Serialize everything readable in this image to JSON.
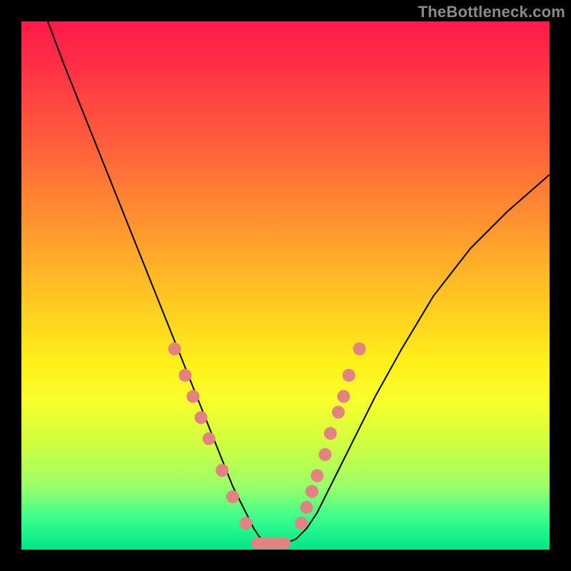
{
  "watermark": "TheBottleneck.com",
  "chart_data": {
    "type": "line",
    "title": "",
    "xlabel": "",
    "ylabel": "",
    "xlim": [
      0,
      100
    ],
    "ylim": [
      0,
      100
    ],
    "grid": false,
    "series": [
      {
        "name": "bottleneck-curve",
        "color": "#000000",
        "x": [
          5,
          8,
          12,
          16,
          20,
          24,
          28,
          30,
          32,
          34,
          36,
          38,
          40,
          42,
          43,
          44,
          45,
          46,
          47,
          48,
          49,
          50,
          52,
          54,
          56,
          58,
          60,
          63,
          67,
          72,
          78,
          85,
          92,
          100
        ],
        "y": [
          100,
          92,
          82,
          72,
          62,
          52,
          42,
          37,
          32,
          27,
          22,
          17,
          12,
          8,
          6,
          4,
          2.5,
          1.5,
          1,
          1,
          1,
          1.2,
          2,
          4,
          7,
          11,
          15,
          21,
          29,
          38,
          48,
          57,
          64,
          71
        ]
      }
    ],
    "markers_left": {
      "color": "#e48281",
      "points": [
        {
          "x": 29.0,
          "y": 38.0
        },
        {
          "x": 31.0,
          "y": 33.0
        },
        {
          "x": 32.5,
          "y": 29.0
        },
        {
          "x": 34.0,
          "y": 25.0
        },
        {
          "x": 35.5,
          "y": 21.0
        },
        {
          "x": 38.0,
          "y": 15.0
        },
        {
          "x": 40.0,
          "y": 10.0
        },
        {
          "x": 42.5,
          "y": 5.0
        }
      ]
    },
    "markers_right": {
      "color": "#e48281",
      "points": [
        {
          "x": 53.0,
          "y": 5.0
        },
        {
          "x": 54.0,
          "y": 8.0
        },
        {
          "x": 55.0,
          "y": 11.0
        },
        {
          "x": 56.0,
          "y": 14.0
        },
        {
          "x": 57.5,
          "y": 18.0
        },
        {
          "x": 58.5,
          "y": 22.0
        },
        {
          "x": 60.0,
          "y": 26.0
        },
        {
          "x": 61.0,
          "y": 29.0
        },
        {
          "x": 62.0,
          "y": 33.0
        },
        {
          "x": 64.0,
          "y": 38.0
        }
      ]
    },
    "bottom_band": {
      "color": "#e48281",
      "x_start": 43.5,
      "x_end": 51.0,
      "y": 1.2,
      "height": 2.2
    }
  }
}
